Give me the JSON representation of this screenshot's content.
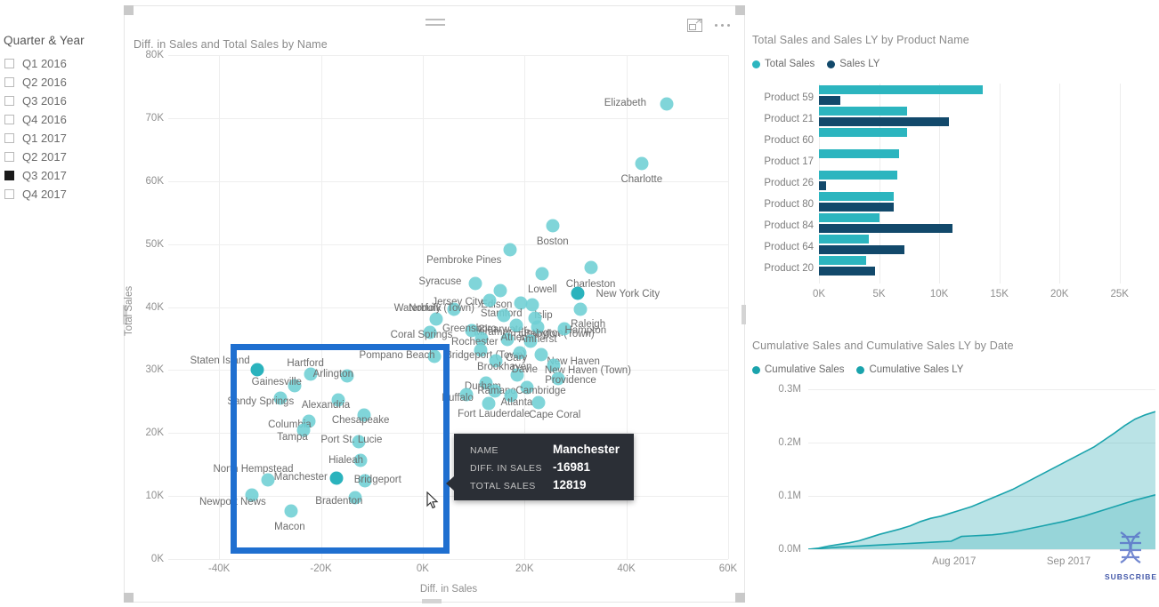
{
  "slicer": {
    "title": "Quarter & Year",
    "items": [
      {
        "label": "Q1 2016",
        "checked": false
      },
      {
        "label": "Q2 2016",
        "checked": false
      },
      {
        "label": "Q3 2016",
        "checked": false
      },
      {
        "label": "Q4 2016",
        "checked": false
      },
      {
        "label": "Q1 2017",
        "checked": false
      },
      {
        "label": "Q2 2017",
        "checked": false
      },
      {
        "label": "Q3 2017",
        "checked": true
      },
      {
        "label": "Q4 2017",
        "checked": false
      }
    ]
  },
  "scatter": {
    "title": "Diff. in Sales and Total Sales by Name",
    "focus_icon": "focus-mode-icon",
    "more_icon": "more-options-icon",
    "chart_data": {
      "type": "scatter",
      "title": "Diff. in Sales and Total Sales by Name",
      "xlabel": "Diff. in Sales",
      "ylabel": "Total Sales",
      "xlim": [
        -50000,
        60000
      ],
      "ylim": [
        0,
        80000
      ],
      "xticks": [
        "-40K",
        "-20K",
        "0K",
        "20K",
        "40K",
        "60K"
      ],
      "yticks": [
        "0K",
        "10K",
        "20K",
        "30K",
        "40K",
        "50K",
        "60K",
        "70K",
        "80K"
      ],
      "grid": true,
      "points": [
        {
          "label": "Elizabeth",
          "x": 48000,
          "y": 72200
        },
        {
          "label": "Charlotte",
          "x": 43000,
          "y": 62800
        },
        {
          "label": "Boston",
          "x": 25500,
          "y": 52900
        },
        {
          "label": "Pembroke Pines",
          "x": 17200,
          "y": 49100
        },
        {
          "label": "Charleston",
          "x": 33000,
          "y": 46300
        },
        {
          "label": "Lowell",
          "x": 23500,
          "y": 45300
        },
        {
          "label": "Syracuse",
          "x": 10400,
          "y": 43800
        },
        {
          "label": "Edison",
          "x": 15200,
          "y": 42600
        },
        {
          "label": "New York City",
          "x": 30500,
          "y": 42200
        },
        {
          "label": "Jersey City",
          "x": 13100,
          "y": 41000
        },
        {
          "label": "Stamford",
          "x": 19300,
          "y": 40700
        },
        {
          "label": "Islip",
          "x": 21600,
          "y": 40400
        },
        {
          "label": "Raleigh",
          "x": 30900,
          "y": 39700
        },
        {
          "label": "Norfolk",
          "x": 6200,
          "y": 39600
        },
        {
          "label": "Clearwater",
          "x": 16000,
          "y": 38600
        },
        {
          "label": "Huntington",
          "x": 22000,
          "y": 38200
        },
        {
          "label": "Waterbury (Town)",
          "x": 2600,
          "y": 38100
        },
        {
          "label": "Miramar",
          "x": 18300,
          "y": 37100
        },
        {
          "label": "Babylon (Town)",
          "x": 22600,
          "y": 36800
        },
        {
          "label": "Hampton",
          "x": 27800,
          "y": 36600
        },
        {
          "label": "Greensboro",
          "x": 9700,
          "y": 36200
        },
        {
          "label": "Coral Springs",
          "x": 1500,
          "y": 36000
        },
        {
          "label": "Rochester",
          "x": 11600,
          "y": 35000
        },
        {
          "label": "Athens",
          "x": 16700,
          "y": 34800
        },
        {
          "label": "Amherst",
          "x": 21200,
          "y": 34600
        },
        {
          "label": "Bridgeport (Town)",
          "x": 11300,
          "y": 33200
        },
        {
          "label": "Cary",
          "x": 19100,
          "y": 32700
        },
        {
          "label": "New Haven",
          "x": 23300,
          "y": 32500
        },
        {
          "label": "Pompano Beach",
          "x": 2300,
          "y": 32200
        },
        {
          "label": "Brookhaven",
          "x": 14300,
          "y": 31400
        },
        {
          "label": "New Haven (Town)",
          "x": 25800,
          "y": 30800
        },
        {
          "label": "Staten Island",
          "x": -32500,
          "y": 30100
        },
        {
          "label": "Hartford",
          "x": -22000,
          "y": 29400
        },
        {
          "label": "Arlington",
          "x": -14800,
          "y": 29000
        },
        {
          "label": "Davie",
          "x": 18600,
          "y": 29200
        },
        {
          "label": "Providence",
          "x": 26600,
          "y": 28600
        },
        {
          "label": "Durham",
          "x": 12500,
          "y": 27900
        },
        {
          "label": "Gainesville",
          "x": -25200,
          "y": 27500
        },
        {
          "label": "Cambridge",
          "x": 20400,
          "y": 27300
        },
        {
          "label": "Ramapo",
          "x": 14200,
          "y": 26600
        },
        {
          "label": "Buffalo",
          "x": 8600,
          "y": 26100
        },
        {
          "label": "Atlanta",
          "x": 17400,
          "y": 25900
        },
        {
          "label": "Sandy Springs",
          "x": -28000,
          "y": 25600
        },
        {
          "label": "Alexandria",
          "x": -16600,
          "y": 25300
        },
        {
          "label": "Fort Lauderdale",
          "x": 12900,
          "y": 24700
        },
        {
          "label": "Cape Coral",
          "x": 22800,
          "y": 24900
        },
        {
          "label": "Chesapeake",
          "x": -11500,
          "y": 22800
        },
        {
          "label": "Columbia",
          "x": -22300,
          "y": 21900
        },
        {
          "label": "Tampa",
          "x": -23500,
          "y": 20400
        },
        {
          "label": "Port St. Lucie",
          "x": -12600,
          "y": 18600
        },
        {
          "label": "Hialeah",
          "x": -12300,
          "y": 15600
        },
        {
          "label": "North Hempstead",
          "x": -30500,
          "y": 12500
        },
        {
          "label": "Manchester",
          "x": -16981,
          "y": 12819
        },
        {
          "label": "Bridgeport",
          "x": -11300,
          "y": 12400
        },
        {
          "label": "Newport News",
          "x": -33500,
          "y": 10100
        },
        {
          "label": "Bradenton",
          "x": -13300,
          "y": 9700
        },
        {
          "label": "Macon",
          "x": -25800,
          "y": 7600
        }
      ]
    },
    "tooltip": {
      "rows": [
        {
          "key": "NAME",
          "value": "Manchester"
        },
        {
          "key": "DIFF. IN SALES",
          "value": "-16981"
        },
        {
          "key": "TOTAL SALES",
          "value": "12819"
        }
      ]
    }
  },
  "bar": {
    "chart_data": {
      "type": "bar",
      "orientation": "horizontal",
      "title": "Total Sales and Sales LY by Product Name",
      "xlabel": "",
      "ylabel": "",
      "xlim": [
        0,
        26500
      ],
      "xticks": [
        "0K",
        "5K",
        "10K",
        "15K",
        "20K",
        "25K"
      ],
      "grid": true,
      "legend_position": "top-left",
      "categories": [
        "Product 59",
        "Product 21",
        "Product 60",
        "Product 17",
        "Product 26",
        "Product 80",
        "Product 84",
        "Product 64",
        "Product 20"
      ],
      "series": [
        {
          "name": "Total Sales",
          "color": "#2cb5bf",
          "values": [
            13600,
            7300,
            7300,
            6650,
            6500,
            6250,
            5050,
            4150,
            3900
          ]
        },
        {
          "name": "Sales LY",
          "color": "#12496b",
          "values": [
            1800,
            10800,
            0,
            0,
            600,
            6250,
            11100,
            7100,
            4700
          ]
        }
      ]
    }
  },
  "area": {
    "chart_data": {
      "type": "area",
      "title": "Cumulative Sales and Cumulative Sales LY by Date",
      "xlabel": "",
      "ylabel": "",
      "ylim": [
        0,
        300000
      ],
      "yticks": [
        "0.0M",
        "0.1M",
        "0.2M",
        "0.3M"
      ],
      "xticks": [
        "Aug 2017",
        "Sep 2017"
      ],
      "grid": true,
      "legend_position": "top-left",
      "series": [
        {
          "name": "Cumulative Sales",
          "color": "#1aa3ac",
          "values": [
            0,
            2000,
            6000,
            9000,
            12000,
            16000,
            22000,
            28000,
            33000,
            38000,
            44000,
            52000,
            58000,
            62000,
            68000,
            74000,
            80000,
            88000,
            96000,
            104000,
            112000,
            122000,
            132000,
            142000,
            152000,
            162000,
            172000,
            182000,
            192000,
            205000,
            218000,
            232000,
            244000,
            252000,
            258000
          ]
        },
        {
          "name": "Cumulative Sales LY",
          "color": "#1aa3ac",
          "values": [
            0,
            1000,
            2500,
            4000,
            5000,
            6000,
            7000,
            8000,
            9000,
            10000,
            11000,
            12000,
            13000,
            14000,
            15000,
            24000,
            25000,
            26000,
            27000,
            29000,
            32000,
            36000,
            40000,
            44000,
            48000,
            52000,
            57000,
            62000,
            68000,
            74000,
            80000,
            86000,
            92000,
            97000,
            102000
          ]
        }
      ]
    },
    "watermark": "SUBSCRIBE"
  }
}
